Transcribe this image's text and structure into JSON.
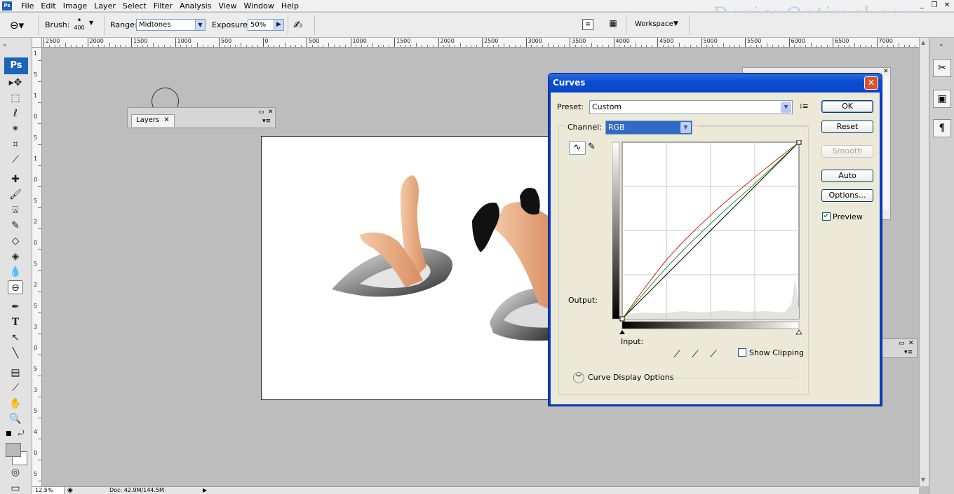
{
  "app": {
    "menu": [
      "File",
      "Edit",
      "Image",
      "Layer",
      "Select",
      "Filter",
      "Analysis",
      "View",
      "Window",
      "Help"
    ],
    "watermark": "DesignOptimal.com",
    "window_controls": [
      "_",
      "❐",
      "✕"
    ]
  },
  "options_bar": {
    "brush_label": "Brush:",
    "brush_size": "400",
    "range_label": "Range:",
    "range_value": "Midtones",
    "exposure_label": "Exposure:",
    "exposure_value": "50%",
    "workspace_label": "Workspace"
  },
  "ruler": {
    "h_ticks": [
      "2500",
      "2000",
      "1500",
      "1000",
      "500",
      "0",
      "500",
      "1000",
      "1500",
      "2000",
      "2500",
      "3000",
      "3500",
      "4000",
      "4500",
      "5000",
      "5500",
      "6000",
      "6500",
      "7000"
    ],
    "v_ticks": [
      "1",
      "5",
      "1",
      "0",
      "5",
      "1",
      "0",
      "5",
      "2",
      "0",
      "5",
      "2",
      "5",
      "3",
      "0",
      "5",
      "3",
      "5",
      "4",
      "0",
      "5"
    ]
  },
  "toolbox": {
    "badge": "Ps"
  },
  "layers_panel": {
    "tab_label": "Layers"
  },
  "status_bar": {
    "zoom": "12.5%",
    "doc": "Doc: 42.9M/144.5M"
  },
  "curves": {
    "title": "Curves",
    "preset_label": "Preset:",
    "preset_value": "Custom",
    "channel_label": "Channel:",
    "channel_value": "RGB",
    "output_label": "Output:",
    "input_label": "Input:",
    "show_clipping_label": "Show Clipping",
    "show_clipping_checked": false,
    "curve_display_options_label": "Curve Display Options",
    "buttons": {
      "ok": "OK",
      "reset": "Reset",
      "smooth": "Smooth",
      "auto": "Auto",
      "options": "Options..."
    },
    "preview_label": "Preview",
    "preview_checked": true,
    "curve_points": {
      "composite": [
        [
          0,
          0
        ],
        [
          255,
          255
        ]
      ],
      "red": [
        [
          0,
          0
        ],
        [
          64,
          85
        ],
        [
          128,
          150
        ],
        [
          192,
          205
        ],
        [
          255,
          255
        ]
      ],
      "green": [
        [
          0,
          0
        ],
        [
          64,
          74
        ],
        [
          128,
          138
        ],
        [
          192,
          196
        ],
        [
          255,
          255
        ]
      ]
    },
    "colors": {
      "composite": "#000000",
      "red": "#cc2222",
      "green": "#229922"
    }
  }
}
